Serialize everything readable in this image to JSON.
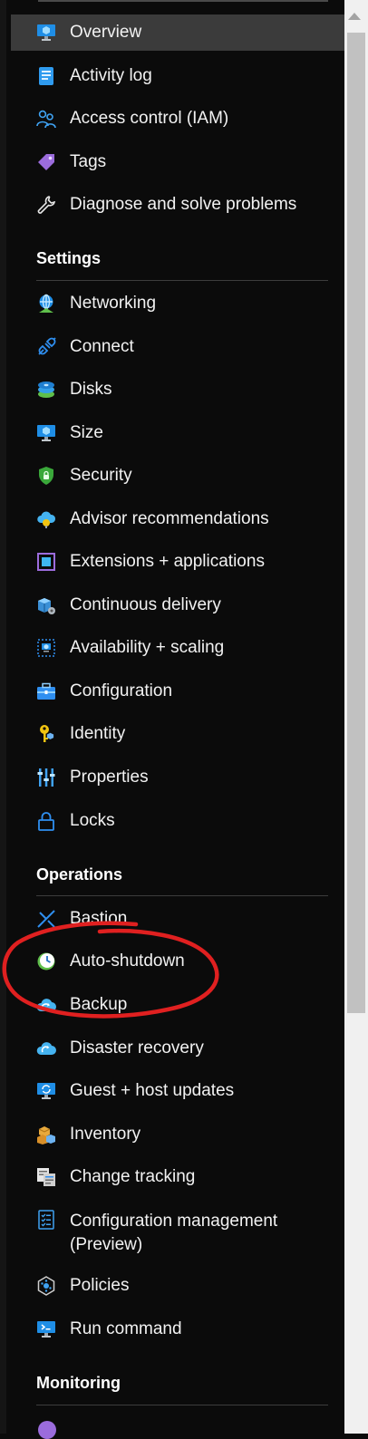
{
  "menu": {
    "top": [
      {
        "label": "Overview",
        "icon": "vm-monitor-icon",
        "active": true
      },
      {
        "label": "Activity log",
        "icon": "activity-log-icon"
      },
      {
        "label": "Access control (IAM)",
        "icon": "people-icon"
      },
      {
        "label": "Tags",
        "icon": "tag-icon"
      },
      {
        "label": "Diagnose and solve problems",
        "icon": "wrench-icon"
      }
    ],
    "sections": [
      {
        "title": "Settings",
        "items": [
          {
            "label": "Networking",
            "icon": "networking-icon"
          },
          {
            "label": "Connect",
            "icon": "plug-icon"
          },
          {
            "label": "Disks",
            "icon": "disks-icon"
          },
          {
            "label": "Size",
            "icon": "vm-monitor-icon"
          },
          {
            "label": "Security",
            "icon": "shield-icon"
          },
          {
            "label": "Advisor recommendations",
            "icon": "advisor-cloud-icon"
          },
          {
            "label": "Extensions + applications",
            "icon": "extensions-icon"
          },
          {
            "label": "Continuous delivery",
            "icon": "continuous-delivery-icon"
          },
          {
            "label": "Availability + scaling",
            "icon": "availability-icon"
          },
          {
            "label": "Configuration",
            "icon": "briefcase-icon"
          },
          {
            "label": "Identity",
            "icon": "key-icon"
          },
          {
            "label": "Properties",
            "icon": "sliders-icon"
          },
          {
            "label": "Locks",
            "icon": "lock-icon"
          }
        ]
      },
      {
        "title": "Operations",
        "items": [
          {
            "label": "Bastion",
            "icon": "bastion-icon"
          },
          {
            "label": "Auto-shutdown",
            "icon": "clock-icon"
          },
          {
            "label": "Backup",
            "icon": "backup-cloud-icon"
          },
          {
            "label": "Disaster recovery",
            "icon": "disaster-recovery-icon"
          },
          {
            "label": "Guest + host updates",
            "icon": "updates-icon"
          },
          {
            "label": "Inventory",
            "icon": "boxes-icon"
          },
          {
            "label": "Change tracking",
            "icon": "documents-icon"
          },
          {
            "label": "Configuration management (Preview)",
            "icon": "checklist-icon"
          },
          {
            "label": "Policies",
            "icon": "policy-icon"
          },
          {
            "label": "Run command",
            "icon": "run-command-icon"
          }
        ]
      },
      {
        "title": "Monitoring",
        "items": []
      }
    ]
  },
  "annotation": {
    "color": "#e02020",
    "target": "Auto-shutdown"
  }
}
